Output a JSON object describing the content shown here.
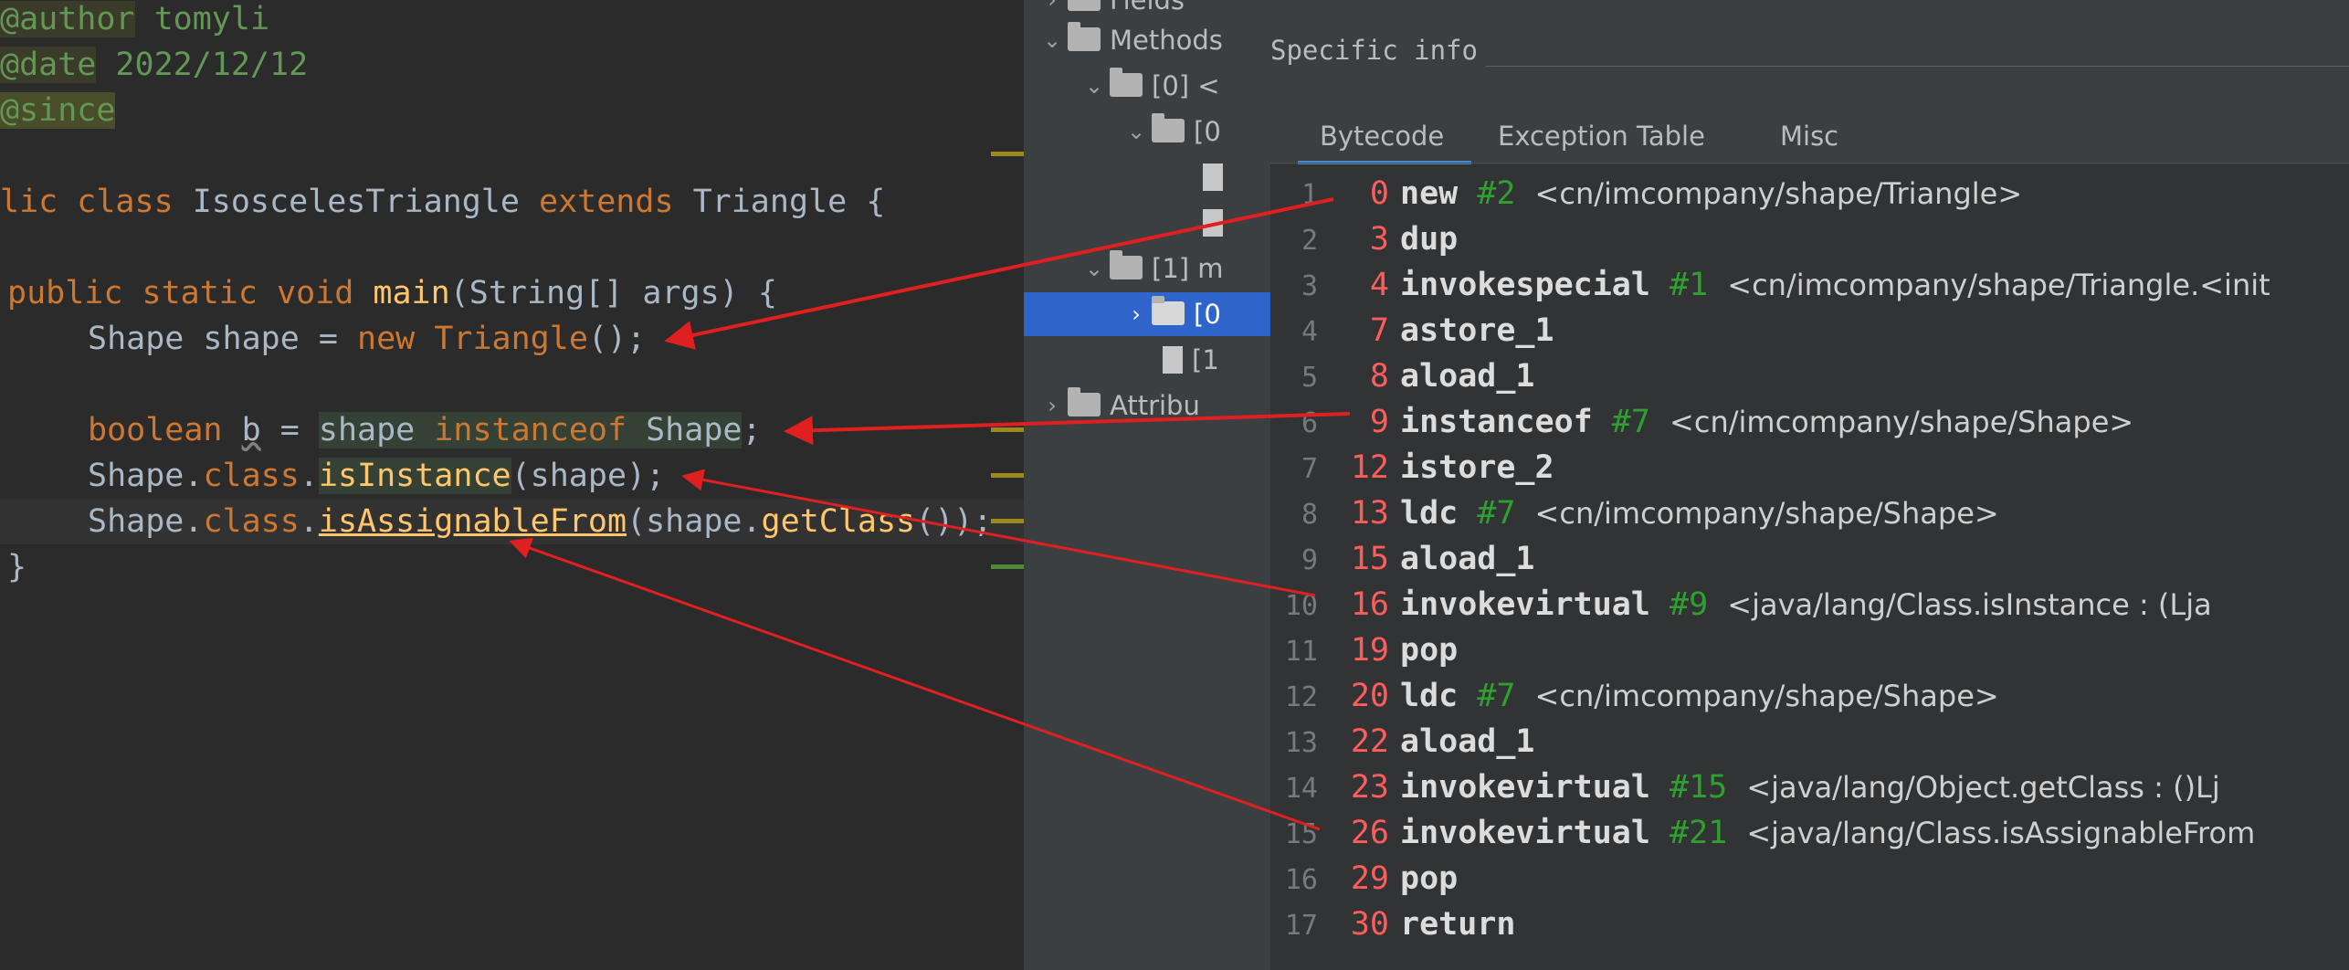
{
  "editor": {
    "lines": [
      [
        "@author tomyli"
      ],
      [
        "@date 2022/12/12"
      ],
      [
        "@since"
      ],
      [
        ""
      ],
      [
        "lic class IsoscelesTriangle extends Triangle {"
      ],
      [
        ""
      ],
      [
        "public static void main(String[] args) {"
      ],
      [
        "Shape shape = new Triangle();"
      ],
      [
        ""
      ],
      [
        "boolean b = shape instanceof Shape;"
      ],
      [
        "Shape.class.isInstance(shape);"
      ],
      [
        "Shape.class.isAssignableFrom(shape.getClass());"
      ],
      [
        "}"
      ]
    ],
    "doc_author": "@author",
    "doc_author_val": " tomyli",
    "doc_date": "@date",
    "doc_date_val": " 2022/12/12",
    "doc_since": "@since",
    "l5_a": "lic class ",
    "l5_b": "IsoscelesTriangle ",
    "l5_c": "extends ",
    "l5_d": "Triangle {",
    "l7_a": "public static void ",
    "l7_b": "main",
    "l7_c": "(String[] args) {",
    "l8_a": "Shape shape = ",
    "l8_b": "new ",
    "l8_c": "Triangle",
    "l8_d": "();",
    "l10_a": "boolean ",
    "l10_b": "b",
    "l10_c": " = ",
    "l10_d": "shape ",
    "l10_e": "instanceof ",
    "l10_f": "Shape",
    "l10_g": ";",
    "l11_a": "Shape.",
    "l11_b": "class",
    "l11_c": ".",
    "l11_d": "isInstance",
    "l11_e": "(shape);",
    "l12_a": "Shape.",
    "l12_b": "class",
    "l12_c": ".",
    "l12_d": "isAssignableFrom",
    "l12_e": "(shape.",
    "l12_f": "getClass",
    "l12_g": "());",
    "l13": "}"
  },
  "tree": {
    "fields": "Fields",
    "methods": "Methods",
    "m0": "[0] <",
    "m0c": "[0",
    "m1": "[1] m",
    "m1c0": "[0",
    "m1c1": "[1",
    "attributes": "Attribu"
  },
  "panel": {
    "specific_info": "Specific info",
    "tabs": [
      "Bytecode",
      "Exception Table",
      "Misc"
    ]
  },
  "bytecode": [
    {
      "ln": "1",
      "off": "0",
      "op": "new",
      "ref": "#2",
      "arg": "<cn/imcompany/shape/Triangle>"
    },
    {
      "ln": "2",
      "off": "3",
      "op": "dup",
      "ref": "",
      "arg": ""
    },
    {
      "ln": "3",
      "off": "4",
      "op": "invokespecial",
      "ref": "#1",
      "arg": "<cn/imcompany/shape/Triangle.<init"
    },
    {
      "ln": "4",
      "off": "7",
      "op": "astore_1",
      "ref": "",
      "arg": ""
    },
    {
      "ln": "5",
      "off": "8",
      "op": "aload_1",
      "ref": "",
      "arg": ""
    },
    {
      "ln": "6",
      "off": "9",
      "op": "instanceof",
      "ref": "#7",
      "arg": "<cn/imcompany/shape/Shape>"
    },
    {
      "ln": "7",
      "off": "12",
      "op": "istore_2",
      "ref": "",
      "arg": ""
    },
    {
      "ln": "8",
      "off": "13",
      "op": "ldc",
      "ref": "#7",
      "arg": "<cn/imcompany/shape/Shape>"
    },
    {
      "ln": "9",
      "off": "15",
      "op": "aload_1",
      "ref": "",
      "arg": ""
    },
    {
      "ln": "10",
      "off": "16",
      "op": "invokevirtual",
      "ref": "#9",
      "arg": "<java/lang/Class.isInstance : (Lja"
    },
    {
      "ln": "11",
      "off": "19",
      "op": "pop",
      "ref": "",
      "arg": ""
    },
    {
      "ln": "12",
      "off": "20",
      "op": "ldc",
      "ref": "#7",
      "arg": "<cn/imcompany/shape/Shape>"
    },
    {
      "ln": "13",
      "off": "22",
      "op": "aload_1",
      "ref": "",
      "arg": ""
    },
    {
      "ln": "14",
      "off": "23",
      "op": "invokevirtual",
      "ref": "#15",
      "arg": "<java/lang/Object.getClass : ()Lj"
    },
    {
      "ln": "15",
      "off": "26",
      "op": "invokevirtual",
      "ref": "#21",
      "arg": "<java/lang/Class.isAssignableFrom"
    },
    {
      "ln": "16",
      "off": "29",
      "op": "pop",
      "ref": "",
      "arg": ""
    },
    {
      "ln": "17",
      "off": "30",
      "op": "return",
      "ref": "",
      "arg": ""
    }
  ],
  "colors": {
    "annotation_arrow": "#e02020",
    "selection": "#2f65ca",
    "keyword": "#cc7832",
    "offset": "#ff5c5c",
    "constant_ref": "#2fa02f"
  }
}
